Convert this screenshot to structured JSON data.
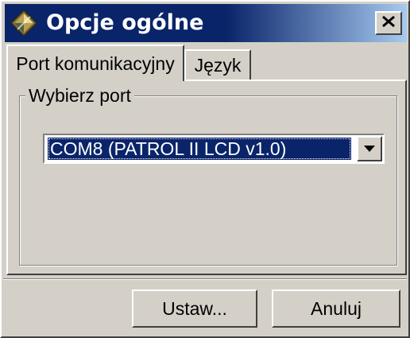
{
  "window": {
    "title": "Opcje ogólne",
    "icon": "diamond-app-icon",
    "close_icon": "close-icon"
  },
  "tabs": [
    {
      "label": "Port komunikacyjny",
      "active": true
    },
    {
      "label": "Język",
      "active": false
    }
  ],
  "port_group": {
    "legend": "Wybierz port",
    "selected_port": "COM8 (PATROL II LCD v1.0)",
    "dropdown_icon": "chevron-down-icon"
  },
  "buttons": {
    "set_label": "Ustaw...",
    "cancel_label": "Anuluj"
  },
  "colors": {
    "titlebar_start": "#0a246a",
    "titlebar_end": "#a6caf0",
    "face": "#d4d0c8",
    "selection": "#0a246a"
  }
}
